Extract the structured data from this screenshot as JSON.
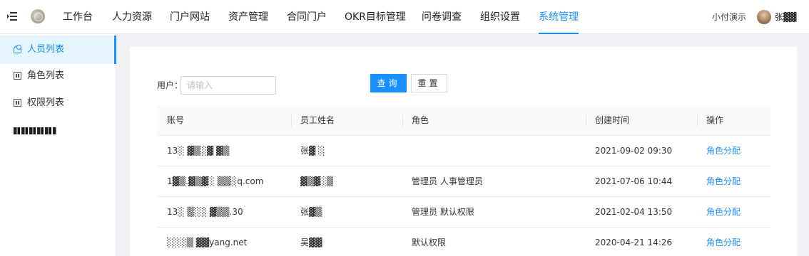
{
  "topnav": {
    "items": [
      "工作台",
      "人力资源",
      "门户网站",
      "资产管理",
      "合同门户",
      "OKR目标管理",
      "问卷调查",
      "组织设置",
      "系统管理"
    ],
    "active_index": 8,
    "demo_label": "小付演示",
    "user_name": "张▓▓"
  },
  "sidebar": {
    "items": [
      {
        "label": "人员列表",
        "icon": "user-icon",
        "active": true
      },
      {
        "label": "角色列表",
        "icon": "table-icon",
        "active": false
      },
      {
        "label": "权限列表",
        "icon": "table-icon",
        "active": false
      }
    ]
  },
  "filter": {
    "user_label": "用户：",
    "user_placeholder": "请输入",
    "search_label": "查询",
    "reset_label": "重置"
  },
  "table": {
    "columns": [
      "账号",
      "员工姓名",
      "角色",
      "创建时间",
      "操作"
    ],
    "rows": [
      {
        "account": "13░ ▓▒░▓ ▓▒",
        "name": "张▓ ░",
        "role": "",
        "created": "2021-09-02 09:30",
        "action": "角色分配"
      },
      {
        "account": "1▓▒.▓▒▓░ ▒▒░q.com",
        "name": "▓▒▓░▒",
        "role": "管理员 人事管理员",
        "created": "2021-07-06 10:44",
        "action": "角色分配"
      },
      {
        "account": "13░ ▒░░ ▓▒▒.30",
        "name": "张▓▒",
        "role": "管理员 默认权限",
        "created": "2021-02-04 13:50",
        "action": "角色分配"
      },
      {
        "account": "░░░▒ ▓▓yang.net",
        "name": "吴▓▓",
        "role": "默认权限",
        "created": "2020-04-21 14:26",
        "action": "角色分配"
      }
    ]
  },
  "colors": {
    "accent": "#1890ff"
  }
}
